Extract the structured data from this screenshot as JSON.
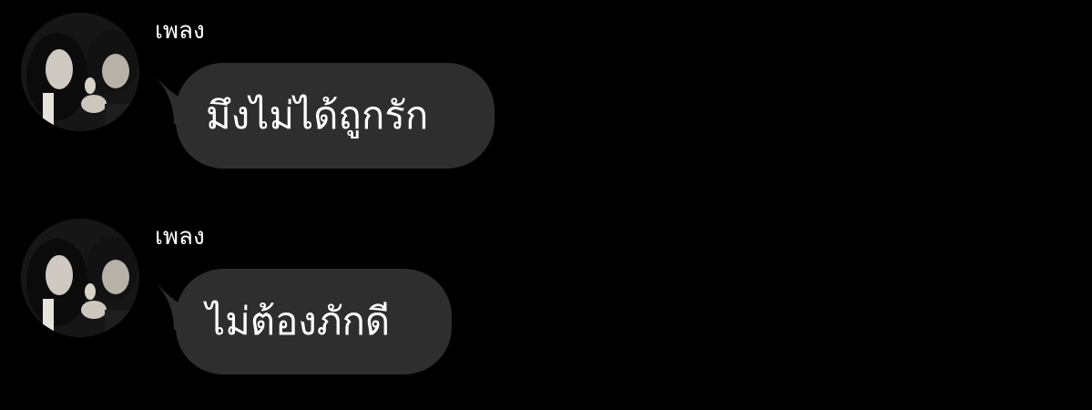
{
  "chat": {
    "bubble_color": "#2e2e2e",
    "background_color": "#000000",
    "messages": [
      {
        "sender": "เพลง",
        "text": "มึงไม่ได้ถูกรัก",
        "avatar": "avatar-photo-icon"
      },
      {
        "sender": "เพลง",
        "text": "ไม่ต้องภักดี",
        "avatar": "avatar-photo-icon"
      }
    ]
  }
}
